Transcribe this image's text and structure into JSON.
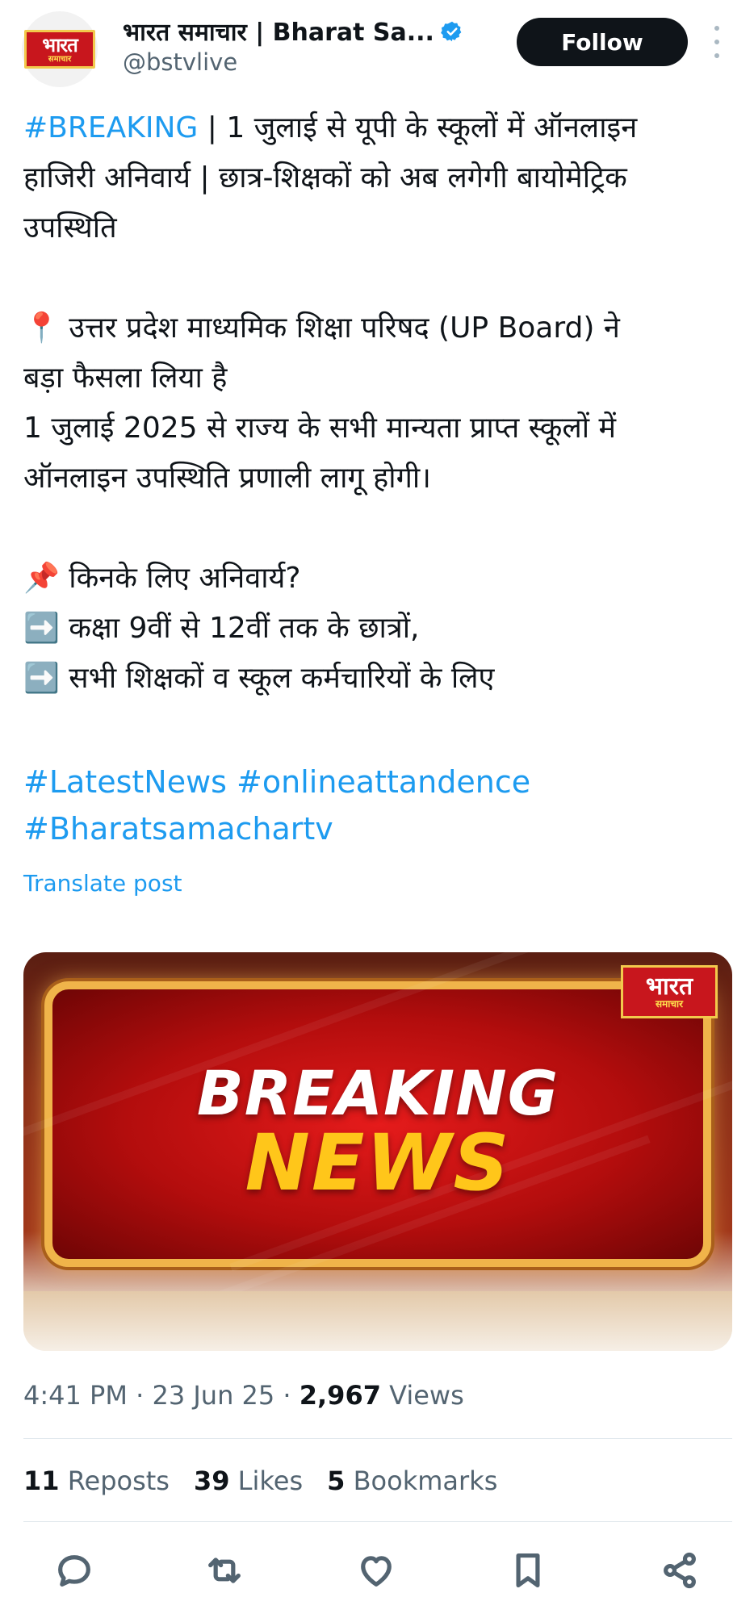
{
  "header": {
    "avatar_logo_top": "भारत",
    "avatar_logo_bottom": "समाचार",
    "display_name": "भारत समाचार | Bharat Sa...",
    "handle": "@bstvlive",
    "follow_label": "Follow",
    "verified_icon": "verified-badge-icon"
  },
  "tweet": {
    "line1_hashtag": "#BREAKING",
    "line1_rest": " | 1 जुलाई से यूपी के स्कूलों में ऑनलाइन",
    "line2": "हाजिरी अनिवार्य | छात्र-शिक्षकों को अब लगेगी बायोमेट्रिक",
    "line3": "उपस्थिति",
    "line4": "📍 उत्तर प्रदेश माध्यमिक शिक्षा परिषद (UP Board) ने",
    "line5": "बड़ा फैसला लिया है",
    "line6": "1 जुलाई 2025 से राज्य के सभी मान्यता प्राप्त स्कूलों में",
    "line7": "ऑनलाइन उपस्थिति प्रणाली लागू होगी।",
    "line8": "📌 किनके लिए अनिवार्य?",
    "line9": "➡️ कक्षा 9वीं से 12वीं तक के छात्रों,",
    "line10": "➡️ सभी शिक्षकों व स्कूल कर्मचारियों के लिए",
    "tags_line1": "#LatestNews #onlineattandence",
    "tags_line2": "#Bharatsamachartv",
    "translate_label": "Translate post"
  },
  "media": {
    "badge_top": "भारत",
    "badge_bottom": "समाचार",
    "headline_top": "BREAKING",
    "headline_bottom": "NEWS"
  },
  "meta": {
    "time": "4:41 PM",
    "sep1": " · ",
    "date": "23 Jun 25",
    "sep2": " · ",
    "views_count": "2,967",
    "views_label": " Views"
  },
  "stats": {
    "reposts_count": "11",
    "reposts_label": " Reposts",
    "likes_count": "39",
    "likes_label": " Likes",
    "bookmarks_count": "5",
    "bookmarks_label": " Bookmarks"
  },
  "actions": [
    "reply-icon",
    "repost-icon",
    "like-icon",
    "bookmark-icon",
    "share-icon"
  ],
  "colors": {
    "link": "#1d9bf0",
    "text": "#0f1419",
    "secondary": "#536471",
    "button_bg": "#0f1419",
    "brand_red": "#c8161d"
  }
}
